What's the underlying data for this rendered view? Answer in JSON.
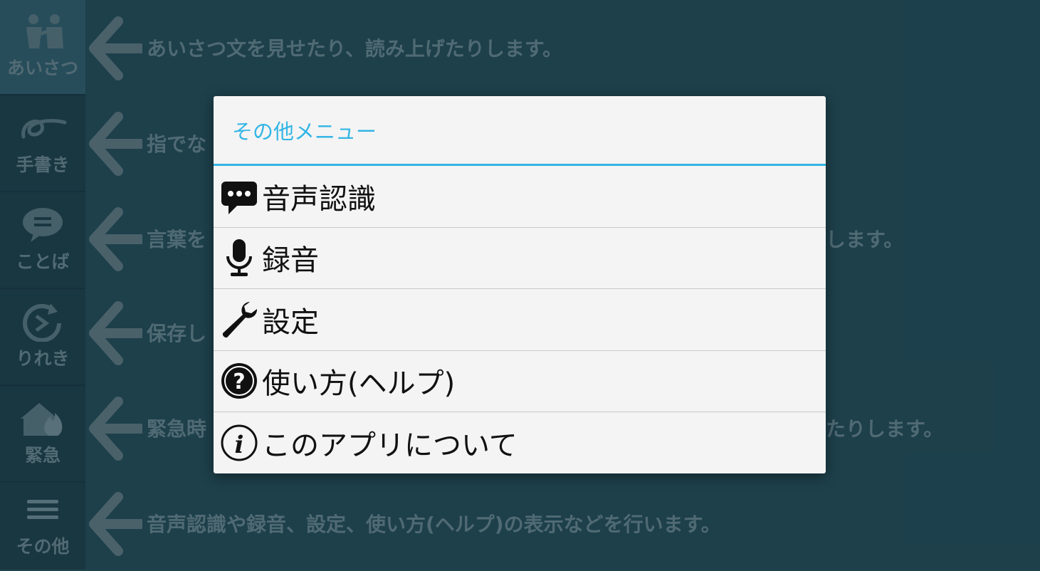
{
  "sidebar": {
    "items": [
      {
        "label": "あいさつ",
        "icon": "greeting-people-icon"
      },
      {
        "label": "手書き",
        "icon": "handwriting-icon"
      },
      {
        "label": "ことば",
        "icon": "speech-bubble-icon"
      },
      {
        "label": "りれき",
        "icon": "history-icon"
      },
      {
        "label": "緊急",
        "icon": "emergency-fire-icon"
      },
      {
        "label": "その他",
        "icon": "hamburger-menu-icon"
      }
    ]
  },
  "help_rows": [
    {
      "text": "あいさつ文を見せたり、読み上げたりします。"
    },
    {
      "text": "指でな"
    },
    {
      "text": "言葉を",
      "tail": "します。"
    },
    {
      "text": "保存し"
    },
    {
      "text": "緊急時",
      "tail": "たりします。"
    },
    {
      "text": "音声認識や録音、設定、使い方(ヘルプ)の表示などを行います。"
    }
  ],
  "dialog": {
    "title": "その他メニュー",
    "items": [
      {
        "label": "音声認識",
        "icon": "speech-bubble-dots-icon"
      },
      {
        "label": "録音",
        "icon": "microphone-icon"
      },
      {
        "label": "設定",
        "icon": "wrench-icon"
      },
      {
        "label": "使い方(ヘルプ)",
        "icon": "help-question-icon"
      },
      {
        "label": "このアプリについて",
        "icon": "info-icon"
      }
    ]
  },
  "colors": {
    "background": "#1f4450",
    "sidebar": "#1b3a44",
    "dialog_accent": "#33b5e5",
    "dimmed_text": "#55707a"
  }
}
